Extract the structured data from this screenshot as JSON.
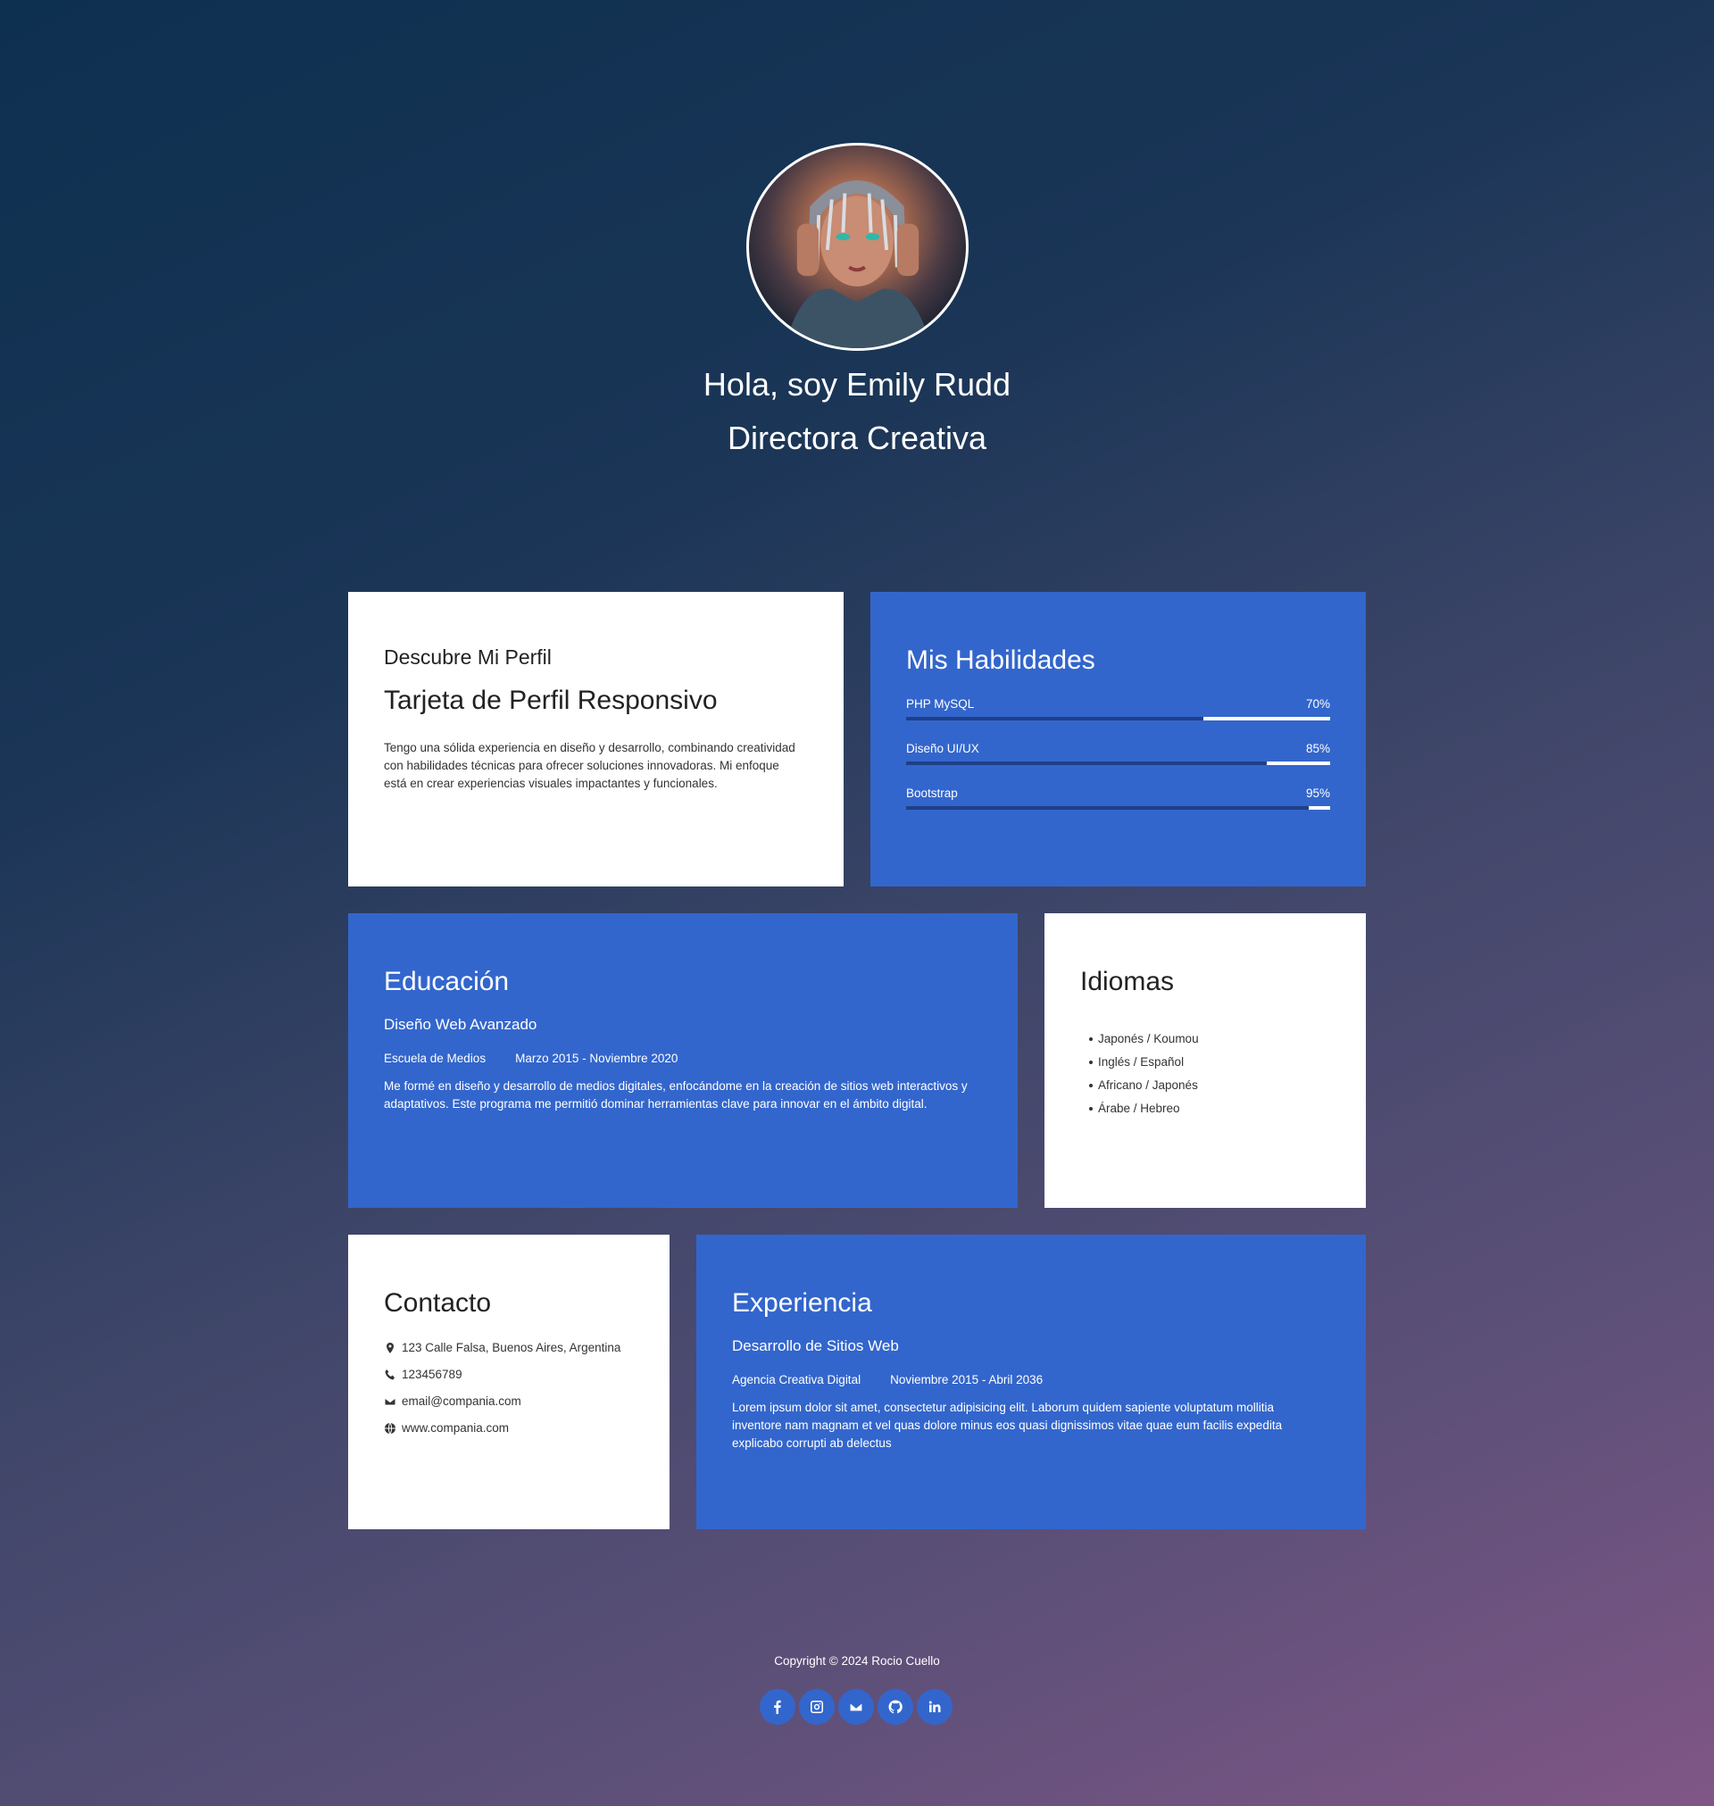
{
  "hero": {
    "name": "Hola, soy Emily Rudd",
    "role": "Directora Creativa",
    "avatar_icon": "avatar-photo"
  },
  "profile": {
    "subtitle": "Descubre Mi Perfil",
    "title": "Tarjeta de Perfil Responsivo",
    "description": "Tengo una sólida experiencia en diseño y desarrollo, combinando creatividad con habilidades técnicas para ofrecer soluciones innovadoras. Mi enfoque está en crear experiencias visuales impactantes y funcionales."
  },
  "skills": {
    "heading": "Mis Habilidades",
    "items": [
      {
        "name": "PHP MySQL",
        "percent_label": "70%",
        "level": 0.7
      },
      {
        "name": "Diseño UI/UX",
        "percent_label": "85%",
        "level": 0.85
      },
      {
        "name": "Bootstrap",
        "percent_label": "95%",
        "level": 0.95
      }
    ]
  },
  "education": {
    "heading": "Educación",
    "course": "Diseño Web Avanzado",
    "school": "Escuela de Medios",
    "dates": "Marzo 2015 - Noviembre 2020",
    "description": "Me formé en diseño y desarrollo de medios digitales, enfocándome en la creación de sitios web interactivos y adaptativos. Este programa me permitió dominar herramientas clave para innovar en el ámbito digital."
  },
  "languages": {
    "heading": "Idiomas",
    "items": [
      "Japonés / Koumou",
      "Inglés / Español",
      "Africano / Japonés",
      "Árabe / Hebreo"
    ]
  },
  "contact": {
    "heading": "Contacto",
    "address": "123 Calle Falsa, Buenos Aires, Argentina",
    "phone": "123456789",
    "email": "email@compania.com",
    "website": "www.compania.com"
  },
  "experience": {
    "heading": "Experiencia",
    "role": "Desarrollo de Sitios Web",
    "company": "Agencia Creativa Digital",
    "dates": "Noviembre 2015 - Abril 2036",
    "description": "Lorem ipsum dolor sit amet, consectetur adipisicing elit. Laborum quidem sapiente voluptatum mollitia inventore nam magnam et vel quas dolore minus eos quasi dignissimos vitae quae eum facilis expedita explicabo corrupti ab delectus"
  },
  "footer": {
    "copyright": "Copyright © 2024 Rocio Cuello",
    "socials": [
      "facebook-icon",
      "instagram-icon",
      "envelope-icon",
      "github-icon",
      "linkedin-icon"
    ]
  },
  "colors": {
    "accent_blue": "#3366cc",
    "card_white": "#ffffff",
    "bar_track": "#1f3f88"
  }
}
